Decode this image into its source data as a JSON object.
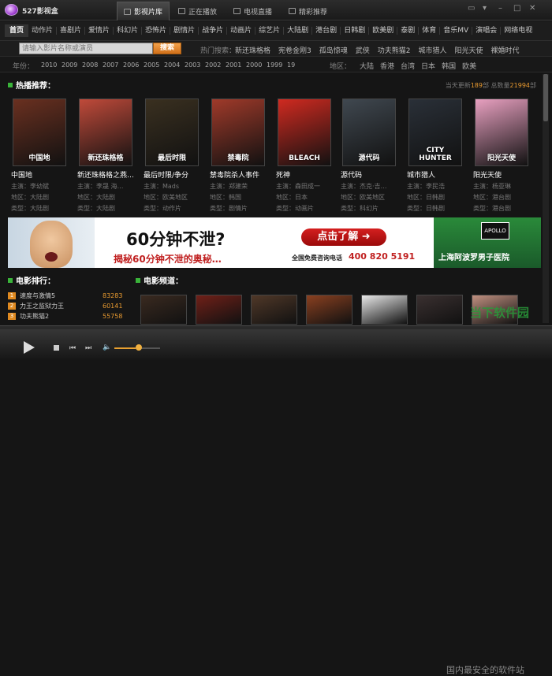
{
  "app": {
    "title": "527影视盒"
  },
  "main_tabs": [
    {
      "label": "影视片库"
    },
    {
      "label": "正在播放"
    },
    {
      "label": "电视直播"
    },
    {
      "label": "精彩推荐"
    }
  ],
  "categories": [
    "首页",
    "动作片",
    "喜剧片",
    "爱情片",
    "科幻片",
    "恐怖片",
    "剧情片",
    "战争片",
    "动画片",
    "综艺片",
    "大陆剧",
    "港台剧",
    "日韩剧",
    "欧美剧",
    "泰剧",
    "体育",
    "音乐MV",
    "演唱会",
    "网络电视"
  ],
  "search": {
    "placeholder": "请输入影片名称或演员",
    "button": "搜索",
    "hot_label": "热门搜索：",
    "hot": [
      "新还珠格格",
      "宪卷金刚3",
      "孤岛惊魂",
      "武侠",
      "功夫熊猫2",
      "城市猎人",
      "阳光天使",
      "裸婚时代"
    ]
  },
  "year": {
    "label": "年份：",
    "years": [
      "2010",
      "2009",
      "2008",
      "2007",
      "2006",
      "2005",
      "2004",
      "2003",
      "2002",
      "2001",
      "2000",
      "1999",
      "19"
    ]
  },
  "region": {
    "label": "地区：",
    "areas": [
      "大陆",
      "香港",
      "台湾",
      "日本",
      "韩国",
      "欧美"
    ]
  },
  "hot": {
    "title": "热播推荐：",
    "stats_prefix": "当天更新",
    "today": "189",
    "stats_mid": "部 总数量",
    "total": "21994",
    "stats_suffix": "部",
    "movies": [
      {
        "title": "中国地",
        "actor": "主演：李幼斌",
        "region": "地区：大陆剧",
        "type": "类型：大陆剧",
        "poster": "#6a3020",
        "poster_text": "中国地"
      },
      {
        "title": "新还珠格格之燕…",
        "actor": "主演：李晟 海…",
        "region": "地区：大陆剧",
        "type": "类型：大陆剧",
        "poster": "#c04a3a",
        "poster_text": "新还珠格格"
      },
      {
        "title": "最后时限/争分",
        "actor": "主演：Mads",
        "region": "地区：欧美地区",
        "type": "类型：动作片",
        "poster": "#3a3020",
        "poster_text": "最后时限"
      },
      {
        "title": "禁毒院杀人事件",
        "actor": "主演：郑建荣",
        "region": "地区：韩国",
        "type": "类型：剧情片",
        "poster": "#a03a2a",
        "poster_text": "禁毒院"
      },
      {
        "title": "死神",
        "actor": "主演：森田成一",
        "region": "地区：日本",
        "type": "类型：动画片",
        "poster": "#d02a20",
        "poster_text": "BLEACH"
      },
      {
        "title": "源代码",
        "actor": "主演：杰克·吉…",
        "region": "地区：欧美地区",
        "type": "类型：科幻片",
        "poster": "#404850",
        "poster_text": "源代码"
      },
      {
        "title": "城市猎人",
        "actor": "主演：李民浩",
        "region": "地区：日韩剧",
        "type": "类型：日韩剧",
        "poster": "#2a3038",
        "poster_text": "CITY HUNTER"
      },
      {
        "title": "阳光天使",
        "actor": "主演：杨亚琳",
        "region": "地区：港台剧",
        "type": "类型：港台剧",
        "poster": "#e8a0c0",
        "poster_text": "阳光天使"
      }
    ]
  },
  "ad": {
    "headline": "60分钟不泄?",
    "sub": "揭秘60分钟不泄的奥秘…",
    "button": "点击了解 ➜",
    "phone_label": "全国免费咨询电话",
    "phone": "400 820 5191",
    "right_text": "上海阿波罗男子医院",
    "right_logo": "APOLLO"
  },
  "ranking": {
    "title": "电影排行：",
    "items": [
      {
        "n": "1",
        "name": "速度与激情5",
        "val": "83283"
      },
      {
        "n": "2",
        "name": "力王之监狱力王",
        "val": "60141"
      },
      {
        "n": "3",
        "name": "功夫熊猫2",
        "val": "55758"
      }
    ]
  },
  "channel": {
    "title": "电影频道：",
    "thumbs": [
      "#3a2a20",
      "#702018",
      "#503828",
      "#8a4020",
      "#e8e8e8",
      "#3a3030",
      "#c09080"
    ]
  },
  "watermark": {
    "site": "当下软件园",
    "footer": "国内最安全的软件站"
  }
}
